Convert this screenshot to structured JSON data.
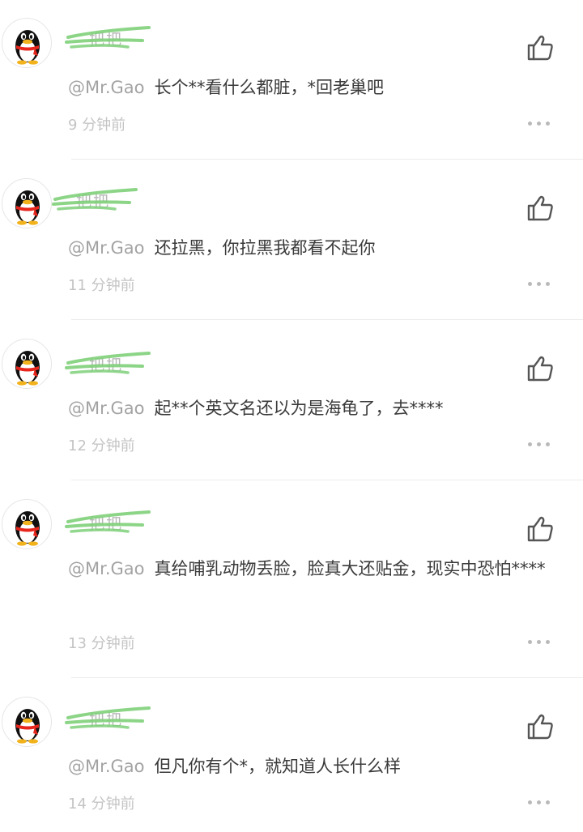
{
  "comments": [
    {
      "username": "把把",
      "mention": "@Mr.Gao",
      "text": "长个**看什么都脏，*回老巢吧",
      "time": "9 分钟前"
    },
    {
      "username": "把把",
      "mention": "@Mr.Gao",
      "text": "还拉黑，你拉黑我都看不起你",
      "time": "11 分钟前"
    },
    {
      "username": "把把",
      "mention": "@Mr.Gao",
      "text": "起**个英文名还以为是海龟了，去****",
      "time": "12 分钟前"
    },
    {
      "username": "把把",
      "mention": "@Mr.Gao",
      "text": "真给哺乳动物丢脸，脸真大还贴金，现实中恐怕****",
      "time": "13 分钟前"
    },
    {
      "username": "把把",
      "mention": "@Mr.Gao",
      "text": "但凡你有个*，就知道人长什么样",
      "time": "14 分钟前"
    }
  ],
  "icons": {
    "avatar": "qq-penguin-avatar-icon",
    "like": "thumbs-up-icon",
    "more": "more-dots-icon",
    "redaction": "green-scribble-redaction"
  },
  "colors": {
    "redaction_green": "#7fd07a",
    "text": "#3a3a3a",
    "mention": "#a3a3a3",
    "time": "#c4c4c4"
  }
}
